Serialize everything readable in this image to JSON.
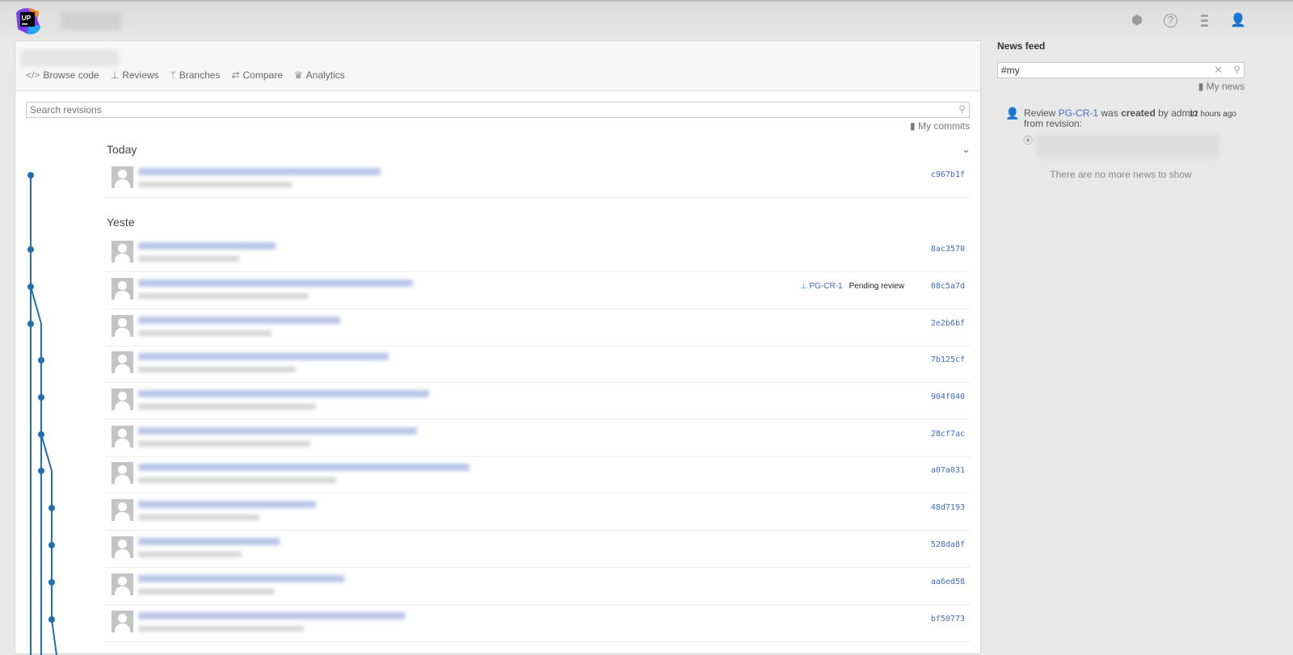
{
  "topbar": {
    "icons": [
      "hub-icon",
      "help-icon",
      "apps-grid-icon",
      "user-icon"
    ]
  },
  "nav": [
    {
      "label": "Browse code",
      "icon": "code-icon"
    },
    {
      "label": "Reviews",
      "icon": "stamp-icon"
    },
    {
      "label": "Branches",
      "icon": "branch-icon"
    },
    {
      "label": "Compare",
      "icon": "compare-arrows-icon"
    },
    {
      "label": "Analytics",
      "icon": "chart-icon"
    }
  ],
  "search": {
    "placeholder": "Search revisions"
  },
  "my_commits": "My commits",
  "groups": {
    "today": "Today",
    "yesterday": "Yeste"
  },
  "revisions": [
    {
      "hash": "c967b1f"
    },
    {
      "hash": "8ac3570"
    },
    {
      "hash": "08c5a7d",
      "review_id": "PG-CR-1",
      "review_status": "Pending review"
    },
    {
      "hash": "2e2b6bf"
    },
    {
      "hash": "7b125cf"
    },
    {
      "hash": "904f040"
    },
    {
      "hash": "28cf7ac"
    },
    {
      "hash": "a07a031"
    },
    {
      "hash": "48d7193"
    },
    {
      "hash": "528da8f"
    },
    {
      "hash": "aa6ed58"
    },
    {
      "hash": "bf50773"
    }
  ],
  "graph_color": "#1f6fb2",
  "feed": {
    "title": "News feed",
    "query": "#my",
    "my_news": "My news",
    "item": {
      "prefix": "Review",
      "review": "PG-CR-1",
      "was": "was",
      "action": "created",
      "by": "by admin",
      "from": "from revision:",
      "time": "12 hours ago"
    },
    "empty": "There are no more news to show"
  }
}
